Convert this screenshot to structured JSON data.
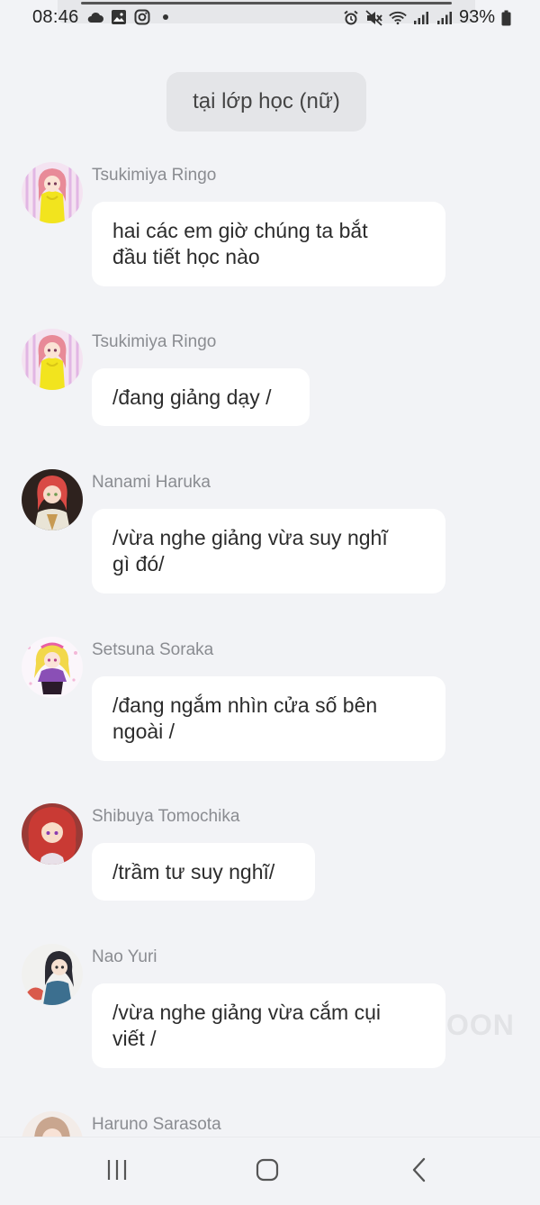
{
  "status_bar": {
    "time": "08:46",
    "left_icons": [
      "cloud-icon",
      "image-icon",
      "instagram-icon",
      "dot-icon"
    ],
    "right_icons": [
      "alarm-icon",
      "mute-icon",
      "wifi-icon",
      "signal-icon",
      "signal-icon"
    ],
    "battery": "93%"
  },
  "scene": {
    "label": "tại lớp học (nữ)"
  },
  "messages": [
    {
      "sender": "Tsukimiya Ringo",
      "text_lines": [
        "hai các em giờ chúng ta bắt",
        "đầu tiết học nào"
      ]
    },
    {
      "sender": "Tsukimiya Ringo",
      "text_lines": [
        "/đang giảng dạy /"
      ]
    },
    {
      "sender": "Nanami Haruka",
      "text_lines": [
        "/vừa nghe giảng vừa suy nghĩ",
        "gì đó/"
      ]
    },
    {
      "sender": "Setsuna Soraka",
      "text_lines": [
        "/đang ngắm nhìn cửa số bên",
        "ngoài /"
      ]
    },
    {
      "sender": "Shibuya Tomochika",
      "text_lines": [
        "/trầm tư suy nghĩ/"
      ]
    },
    {
      "sender": "Nao Yuri",
      "text_lines": [
        "/vừa nghe giảng vừa cắm cụi",
        "viết /"
      ]
    },
    {
      "sender": "Haruno Sarasota",
      "text_lines": []
    }
  ],
  "watermark": "OON",
  "nav_bar": {
    "buttons": [
      "recent-apps-icon",
      "home-icon",
      "back-icon"
    ]
  },
  "colors": {
    "background": "#f2f3f6",
    "bubble": "#ffffff",
    "pill": "#e4e5e8",
    "sender": "#8a8c91",
    "text": "#2c2c2c"
  }
}
